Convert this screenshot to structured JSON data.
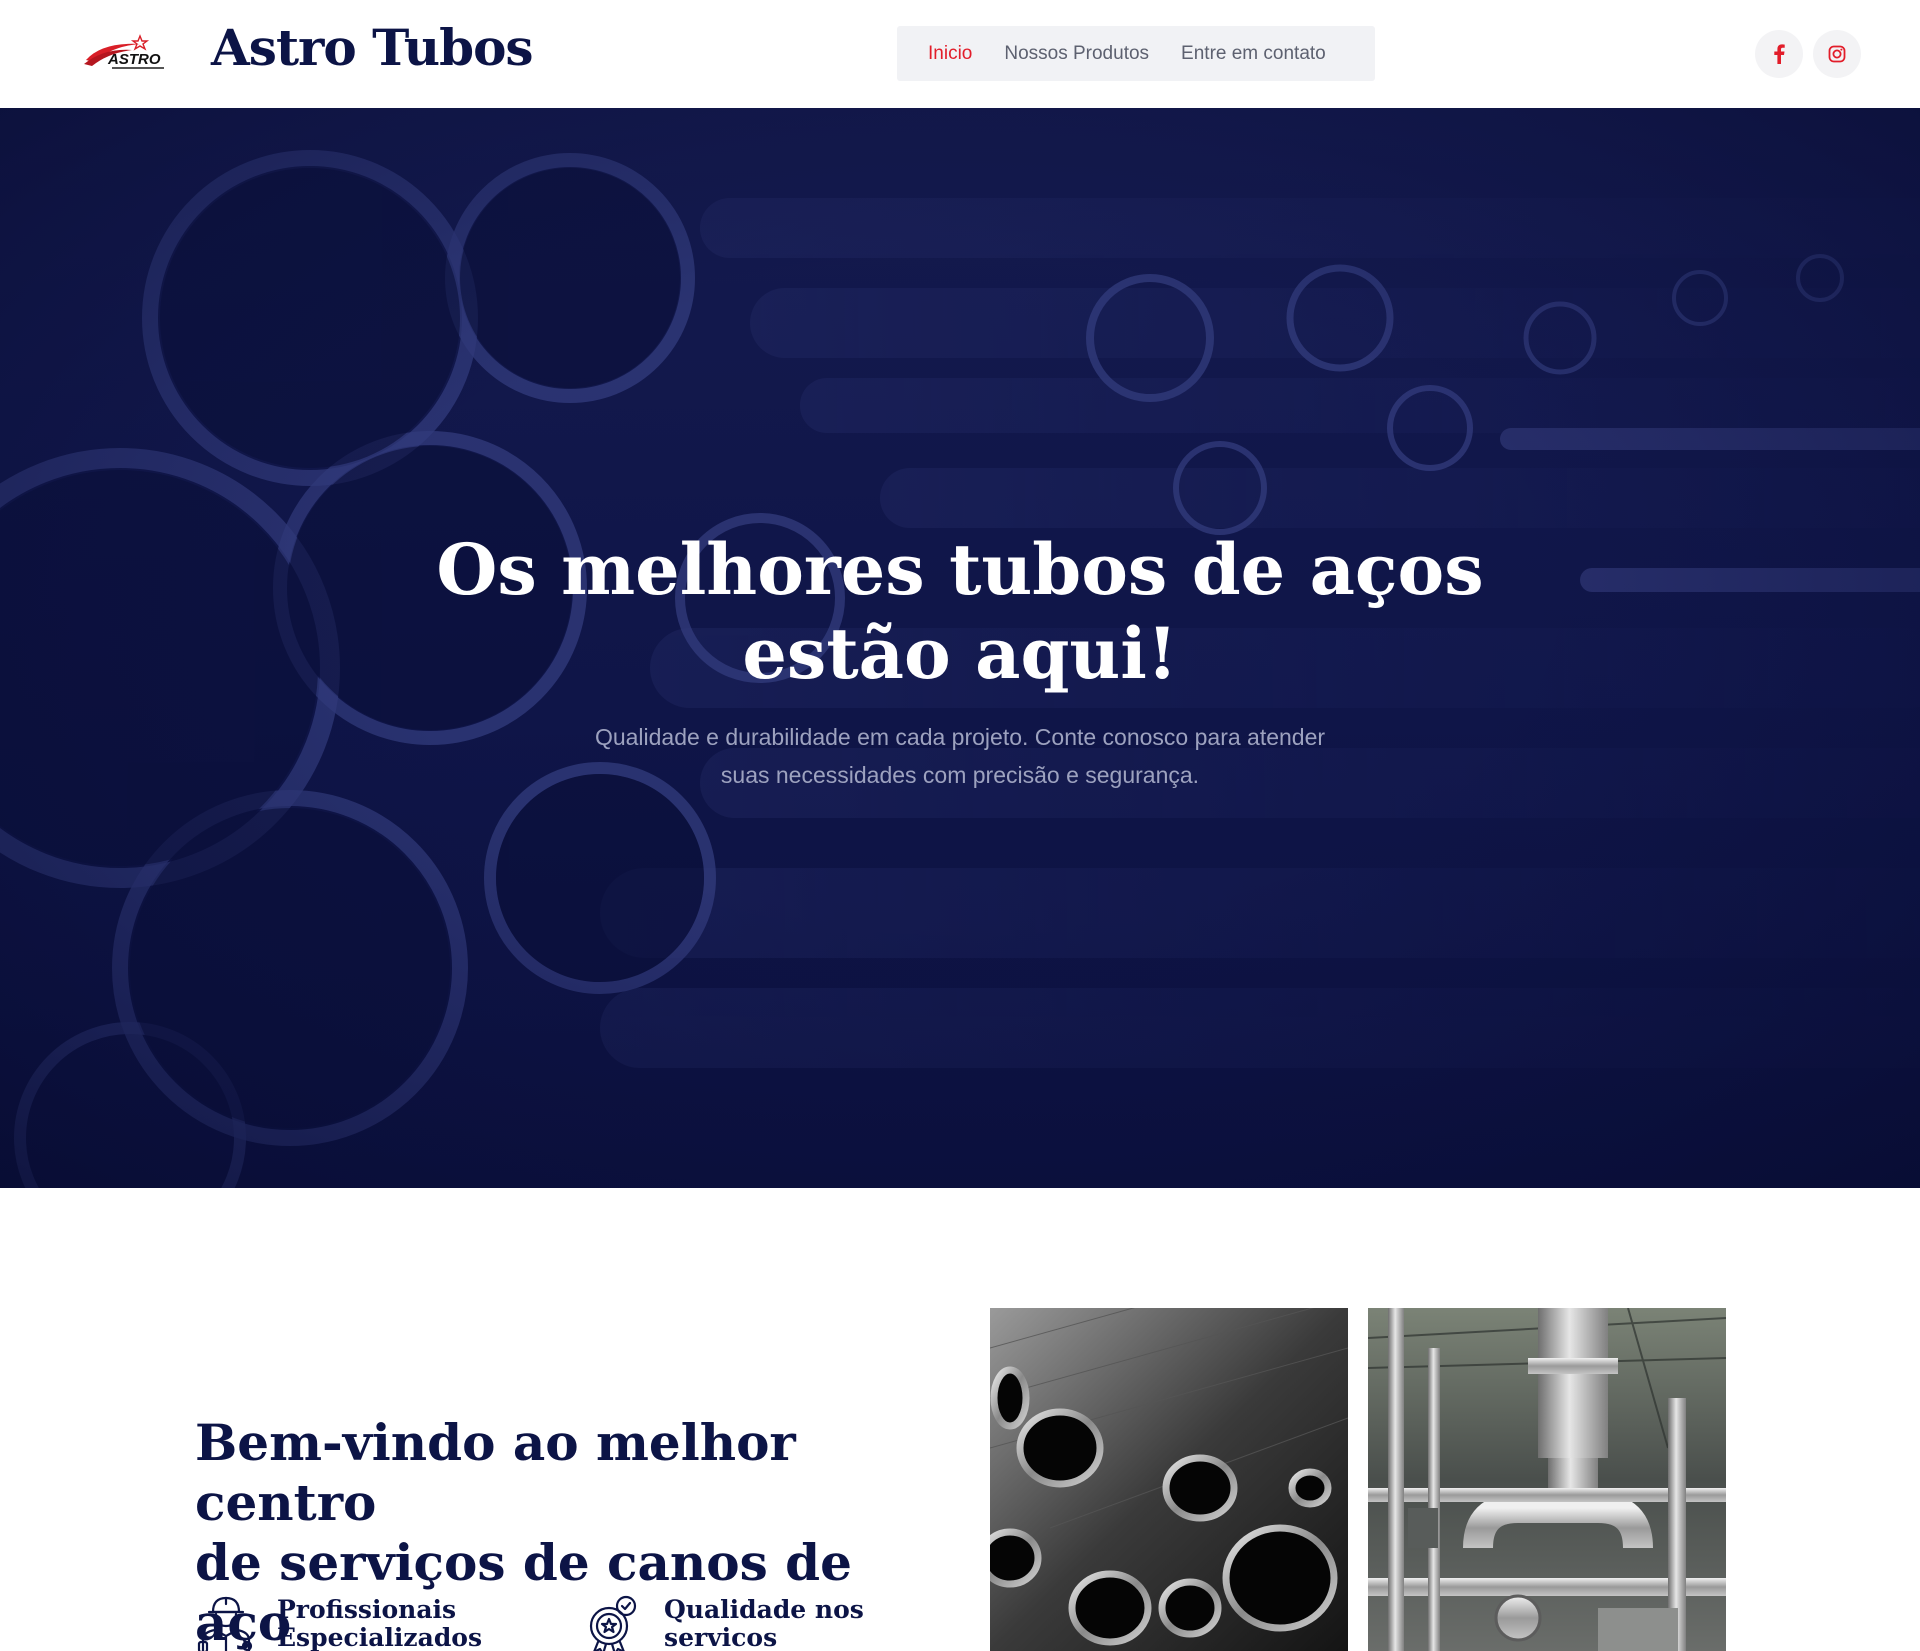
{
  "header": {
    "brand": "Astro Tubos",
    "logo_text": "ASTRO",
    "nav": [
      {
        "label": "Inicio",
        "active": true
      },
      {
        "label": "Nossos Produtos",
        "active": false
      },
      {
        "label": "Entre em contato",
        "active": false
      }
    ],
    "social": [
      {
        "icon": "facebook-icon"
      },
      {
        "icon": "instagram-icon"
      }
    ]
  },
  "hero": {
    "title_line1": "Os melhores tubos de aços",
    "title_line2": "estão aqui!",
    "subtitle_line1": "Qualidade e durabilidade em cada projeto. Conte conosco para atender",
    "subtitle_line2": "suas necessidades com precisão e segurança."
  },
  "welcome": {
    "title_line1": "Bem-vindo ao melhor centro",
    "title_line2": "de serviços de canos de aço",
    "features": [
      {
        "icon": "worker-icon",
        "line1": "Profissionais",
        "line2": "Especializados"
      },
      {
        "icon": "quality-badge-icon",
        "line1": "Qualidade nos",
        "line2": "servicos"
      }
    ]
  },
  "colors": {
    "primary_navy": "#0c1446",
    "accent_red": "#e21d2a",
    "nav_bg": "#f1f2f5",
    "hero_overlay": "#0f1548"
  }
}
